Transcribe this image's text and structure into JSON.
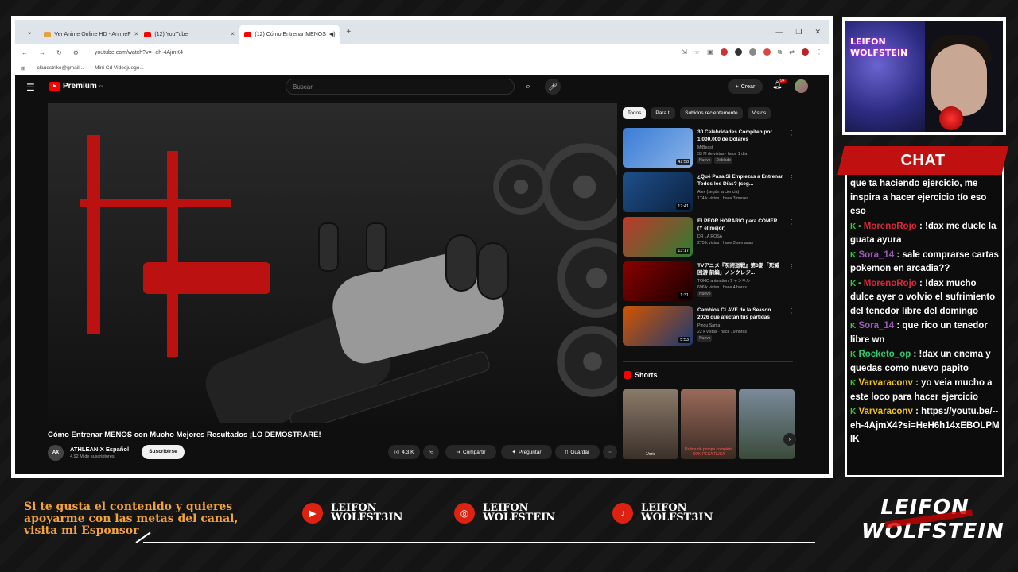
{
  "browser": {
    "tabs": [
      {
        "label": "Ver Anime Online HD - AnimeF",
        "favicon_color": "#e6a23c"
      },
      {
        "label": "(12) YouTube",
        "favicon_color": "#ff0000"
      },
      {
        "label": "(12) Cómo Entrenar MENOS",
        "favicon_color": "#ff0000"
      }
    ],
    "new_tab": "+",
    "url": "youtube.com/watch?v=--eh-4AjmX4",
    "bookmarks": [
      "claudstrike@gmail...",
      "Mini Cd Videojuego..."
    ]
  },
  "youtube": {
    "logo_text": "Premium",
    "logo_country": "CL",
    "search_placeholder": "Buscar",
    "create_label": "Crear",
    "notifications_badge": "9+",
    "video": {
      "title": "Cómo Entrenar MENOS con Mucho Mejores Resultados ¡LO DEMOSTRARÉ!",
      "channel": "ATHLEAN-X Español",
      "channel_avatar": "AX",
      "subscribers": "4.92 M de suscriptores",
      "subscribe_label": "Suscribirse",
      "likes": "4.3 K",
      "share_label": "Compartir",
      "ask_label": "Preguntar",
      "save_label": "Guardar",
      "more_label": "⋯"
    },
    "chips": [
      "Todos",
      "Para ti",
      "Subidos recientemente",
      "Vistos"
    ],
    "recommendations": [
      {
        "title": "30 Celebridades Compiten por 1,000,000 de Dólares",
        "channel": "MrBeast",
        "meta": "33 M de vistas · hace 1 día",
        "tags": [
          "Nuevo",
          "Doblado"
        ],
        "duration": "41:58",
        "thumb": "#3a7bd5"
      },
      {
        "title": "¿Qué Pasa Si Empiezas a Entrenar Todos los Días? (seg...",
        "channel": "Alex (según la ciencia)",
        "meta": "174 k vistas · hace 3 meses",
        "tags": [],
        "duration": "17:41",
        "thumb": "#1e4f8a"
      },
      {
        "title": "El PEOR HORARIO para COMER (Y el mejor)",
        "channel": "DR LA ROSA",
        "meta": "275 k vistas · hace 3 semanas",
        "tags": [],
        "duration": "13:17",
        "thumb": "#c0392b"
      },
      {
        "title": "TVアニメ『呪術廻戦』第3期「死滅回游 前編」ノンクレジ...",
        "channel": "TOHO animation チャンネル",
        "meta": "696 k vistas · hace 4 horas",
        "tags": [
          "Nuevo"
        ],
        "duration": "1:31",
        "thumb": "#8b0000"
      },
      {
        "title": "Cambios CLAVE de la Season 2026 que afectan tus partidas",
        "channel": "Pingu Sama",
        "meta": "22 k vistas · hace 19 horas",
        "tags": [
          "Nuevo"
        ],
        "duration": "5:53",
        "thumb": "#d35400"
      }
    ],
    "shorts_label": "Shorts",
    "shorts": [
      {
        "caption": "1/orie",
        "color": "#6b5a4a"
      },
      {
        "caption": "Rutina de pompa completa CON PESA RUSA",
        "color": "#7a4a3a"
      },
      {
        "caption": "",
        "color": "#5a6a7a"
      }
    ]
  },
  "webcam": {
    "overlay_text_1": "LEIFON",
    "overlay_text_2": "WOLFSTEIN"
  },
  "chat": {
    "title": "CHAT",
    "messages": [
      {
        "user": "",
        "user_color": "#ffffff",
        "text": "que ta haciendo ejercicio, me inspira a hacer ejercicio tío eso eso"
      },
      {
        "user": "MorenoRojo",
        "user_color": "#e0243a",
        "text": ": !dax me duele la guata ayura"
      },
      {
        "user": "Sora_14",
        "user_color": "#9b59b6",
        "text": ": sale comprarse cartas pokemon en arcadia??"
      },
      {
        "user": "MorenoRojo",
        "user_color": "#e0243a",
        "text": ": !dax mucho dulce ayer o volvio el sufrimiento del tenedor libre del domingo"
      },
      {
        "user": "Sora_14",
        "user_color": "#9b59b6",
        "text": ": que rico un tenedor libre wn"
      },
      {
        "user": "Rocketo_op",
        "user_color": "#2ecc71",
        "text": ": !dax un enema y quedas como nuevo papito"
      },
      {
        "user": "Varvaraconv",
        "user_color": "#f1c40f",
        "text": ": yo veia mucho a este loco para hacer ejercicio"
      },
      {
        "user": "Varvaraconv",
        "user_color": "#f1c40f",
        "text": ": https://youtu.be/--eh-4AjmX4?si=HeH6h14xEBOLPMIK"
      }
    ]
  },
  "footer": {
    "sponsor_text": "Si te gusta el contenido y quieres apoyarme con las metas del canal, visita mi Esponsor",
    "socials": [
      {
        "icon": "youtube-icon",
        "glyph": "▶",
        "line1": "LEIFON",
        "line2": "WOLFST3IN"
      },
      {
        "icon": "instagram-icon",
        "glyph": "◎",
        "line1": "LEIFON",
        "line2": "WOLFSTEIN"
      },
      {
        "icon": "tiktok-icon",
        "glyph": "♪",
        "line1": "LEIFON",
        "line2": "WOLFST3IN"
      }
    ],
    "brand_line1": "LEIFON",
    "brand_line2": "WOLFSTEIN"
  }
}
